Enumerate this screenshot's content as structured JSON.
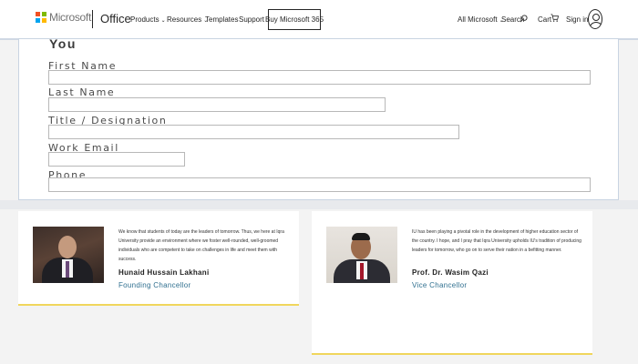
{
  "header": {
    "brand": "Microsoft",
    "product": "Office",
    "nav": {
      "products": "Products",
      "resources": "Resources",
      "templates": "Templates",
      "support": "Support"
    },
    "buy_button": "Buy Microsoft 365",
    "all_microsoft": "All Microsoft",
    "search": "Search",
    "cart": "Cart",
    "sign_in": "Sign in",
    "icons": [
      "microsoft-logo-icon",
      "chevron-down-icon",
      "search-icon",
      "cart-icon",
      "account-avatar-icon"
    ],
    "logo_colors": [
      "#f25022",
      "#7fba00",
      "#00a4ef",
      "#ffb900"
    ]
  },
  "form": {
    "heading": "You",
    "fields": [
      {
        "label": "First Name",
        "value": ""
      },
      {
        "label": "Last Name",
        "value": ""
      },
      {
        "label": "Title / Designation",
        "value": ""
      },
      {
        "label": "Work Email",
        "value": ""
      },
      {
        "label": "Phone",
        "value": ""
      }
    ]
  },
  "cards": [
    {
      "quote": "We know that students of today are the leaders of tomorrow. Thus, we here at Iqra University provide an environment where we foster well-rounded, well-groomed individuals who are competent to take on challenges in life and meet them with success.",
      "name": "Hunaid Hussain Lakhani",
      "role": "Founding Chancellor"
    },
    {
      "quote": "IU has been playing a pivotal role in the development of higher education sector of the country. I hope, and I pray that Iqra University upholds IU's tradition of producing leaders for tomorrow, who go on to serve their nation in a befitting manner.",
      "name": "Prof. Dr. Wasim Qazi",
      "role": "Vice Chancellor"
    }
  ],
  "colors": {
    "accent_border": "#f0d65c",
    "role_text": "#2f6f8f"
  }
}
